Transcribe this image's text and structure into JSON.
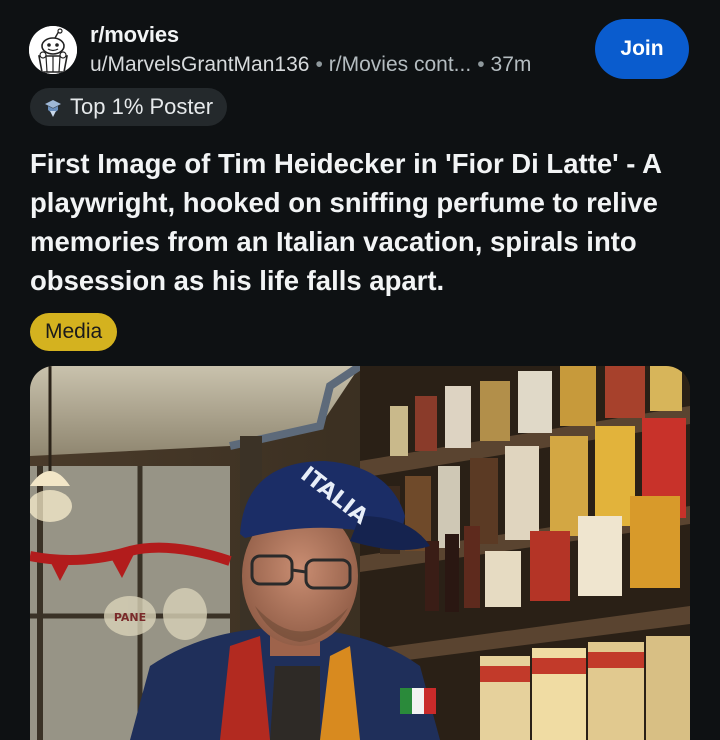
{
  "post": {
    "subreddit": "r/movies",
    "author": "u/MarvelsGrantMan136",
    "crosspost": "r/Movies cont...",
    "time": "37m",
    "join_label": "Join",
    "flair_badge": "Top 1% Poster",
    "title": "First Image of Tim Heidecker in 'Fior Di Latte' - A playwright, hooked on sniffing perfume to relive memories from an Italian vacation, spirals into obsession as his life falls apart.",
    "tag": "Media",
    "image": {
      "cap_text": "ITALIA",
      "window_text": "PANE"
    }
  },
  "icons": {
    "avatar": "snoo-popcorn-avatar",
    "badge": "top-poster-badge-icon"
  },
  "colors": {
    "background": "#0e1113",
    "join_button": "#0a5cce",
    "tag": "#d4b21f",
    "badge": "#24292c"
  }
}
